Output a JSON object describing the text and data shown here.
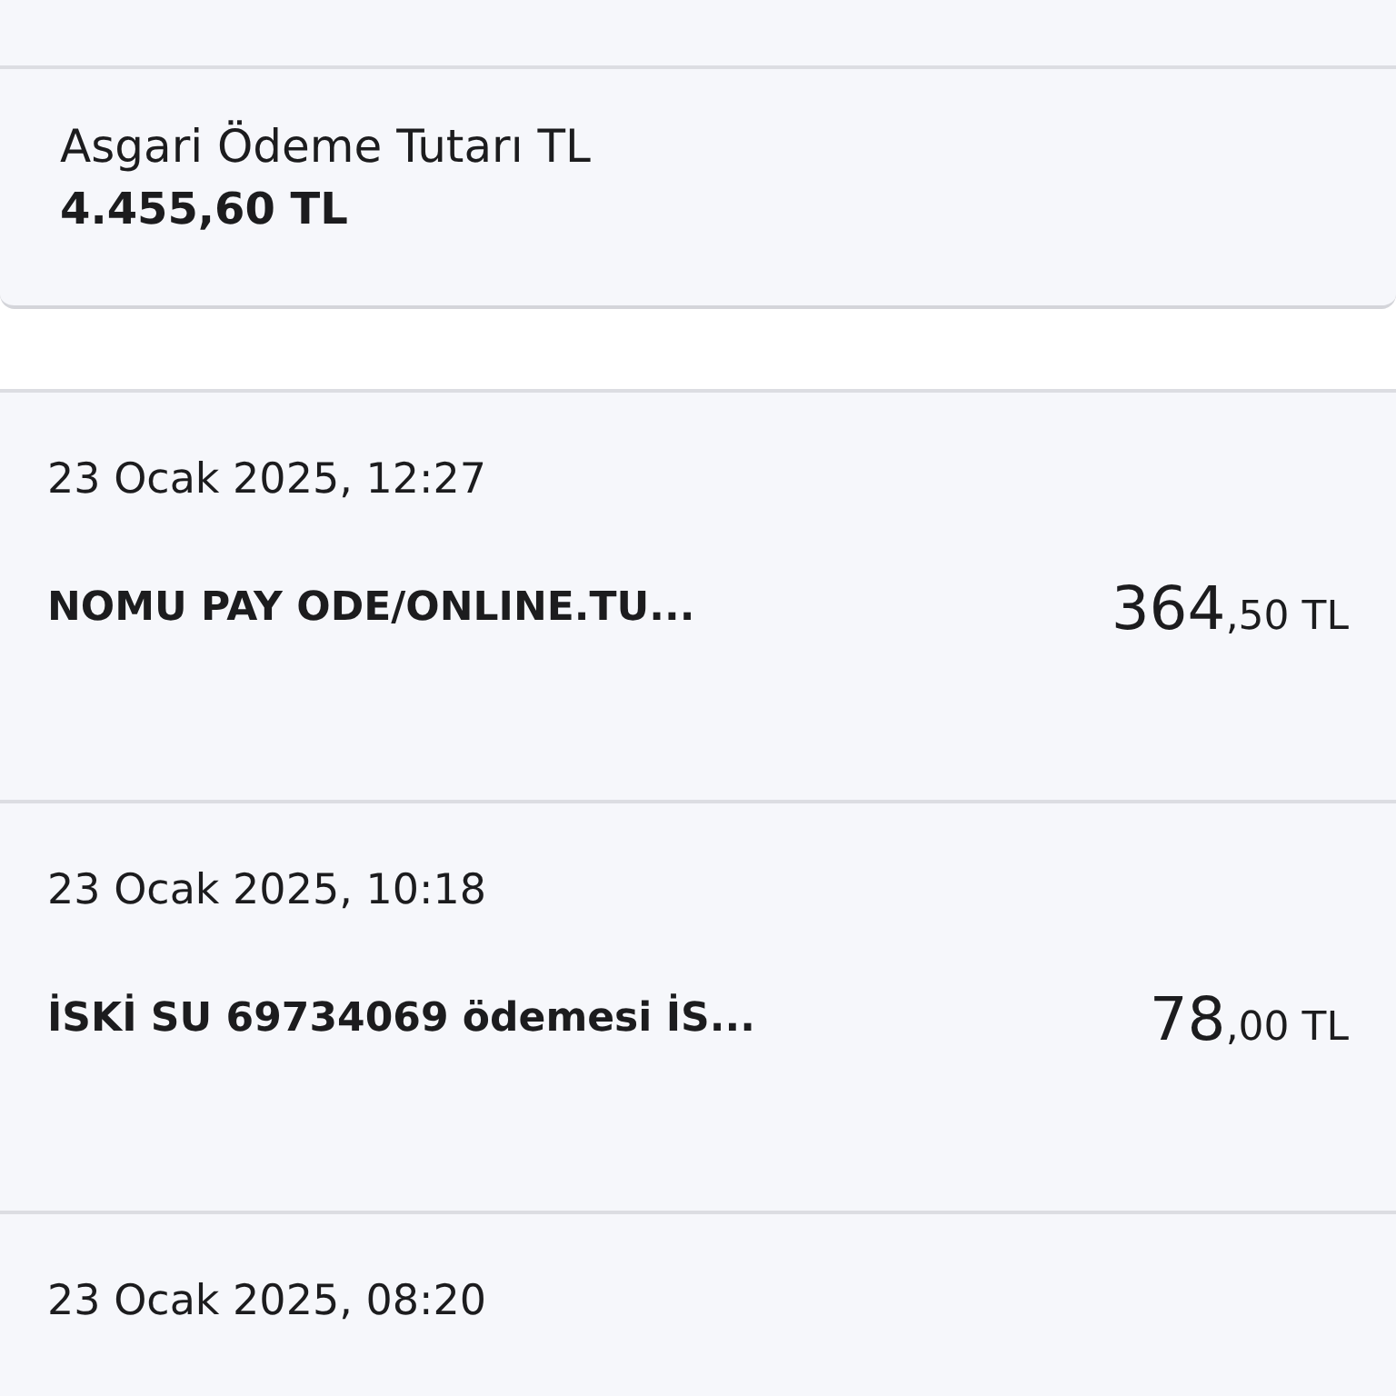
{
  "summary": {
    "label": "Asgari Ödeme Tutarı TL",
    "value": "4.455,60 TL"
  },
  "transactions": [
    {
      "date": "23 Ocak 2025, 12:27",
      "description": "NOMU PAY ODE/ONLINE.TU...",
      "amount_whole": "364",
      "amount_rest": ",50 TL"
    },
    {
      "date": "23 Ocak 2025, 10:18",
      "description": "İSKİ SU 69734069 ödemesi İS...",
      "amount_whole": "78",
      "amount_rest": ",00 TL"
    },
    {
      "date": "23 Ocak 2025, 08:20"
    }
  ]
}
